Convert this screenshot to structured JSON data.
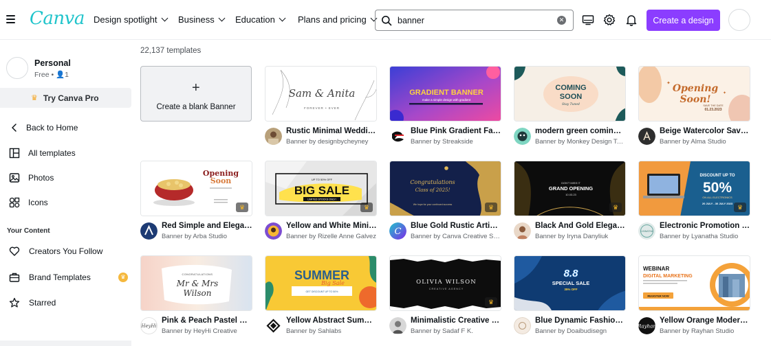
{
  "header": {
    "logo_text": "Canva",
    "nav": [
      {
        "label": "Design spotlight"
      },
      {
        "label": "Business"
      },
      {
        "label": "Education"
      },
      {
        "label": "Plans and pricing"
      }
    ],
    "search_value": "banner",
    "create_label": "Create a design",
    "icons": [
      "monitor-icon",
      "gear-icon",
      "bell-icon"
    ]
  },
  "sidebar": {
    "account_name": "Personal",
    "account_sub": "Free • 👤1",
    "try_pro_label": "Try Canva Pro",
    "items": [
      {
        "label": "Back to Home",
        "icon": "chevron-left-icon"
      },
      {
        "label": "All templates",
        "icon": "templates-icon"
      },
      {
        "label": "Photos",
        "icon": "photo-icon"
      },
      {
        "label": "Icons",
        "icon": "shapes-icon"
      }
    ],
    "section_title": "Your Content",
    "content_items": [
      {
        "label": "Creators You Follow",
        "icon": "heart-icon"
      },
      {
        "label": "Brand Templates",
        "icon": "briefcase-icon"
      },
      {
        "label": "Starred",
        "icon": "star-icon"
      }
    ]
  },
  "main": {
    "count": "22,137 templates",
    "blank_label": "Create a blank Banner",
    "blank_plus": "+",
    "templates": [
      {
        "title": "Rustic Minimal Wedding Banner",
        "by": "Banner by designbycheyney",
        "thumb": {
          "a": "Sam & Anita",
          "b": "FOREVER • EVER"
        }
      },
      {
        "title": "Blue Pink Gradient Fashion Banner",
        "by": "Banner by Streakside",
        "thumb": {
          "a": "GRADIENT BANNER",
          "b": "make a simple design with gradient"
        }
      },
      {
        "title": "modern green coming soon banner",
        "by": "Banner by Monkey Design Team",
        "thumb": {
          "a": "COMING",
          "b": "SOON",
          "c": "Stay Tuned"
        }
      },
      {
        "title": "Beige Watercolor Save the Date",
        "by": "Banner by Alma Studio",
        "thumb": {
          "a": "Opening",
          "b": "Soon!",
          "c": "SAVE THE DATE",
          "d": "01.23.2023"
        }
      },
      {
        "title": "Red Simple and Elegant Banner",
        "by": "Banner by Arba Studio",
        "thumb": {
          "a": "Opening",
          "b": "Soon"
        }
      },
      {
        "title": "Yellow and White Minimalist Banner",
        "by": "Banner by Rizelle Anne Galvez",
        "thumb": {
          "a": "UP TO 50% OFF",
          "b": "BIG SALE",
          "c": "LIMITED STOCKS ONLY!"
        }
      },
      {
        "title": "Blue Gold Rustic Artistic Banner",
        "by": "Banner by Canva Creative Studio",
        "thumb": {
          "a": "Congratulations",
          "b": "Class of 2025!",
          "c": "We hope for your continued success"
        }
      },
      {
        "title": "Black And Gold Elegant Banner",
        "by": "Banner by Iryna Danyliuk",
        "thumb": {
          "a": "DON'T MISS IT",
          "b": "GRAND OPENING",
          "c": "10.03.23"
        }
      },
      {
        "title": "Electronic Promotion Banner",
        "by": "Banner by Lyanatha Studio",
        "thumb": {
          "a": "DISCOUNT UP TO",
          "b": "50%",
          "c": "ON ALL ELECTRONICS",
          "d": "20 JULY - 30 JULY 2023"
        }
      },
      {
        "title": "Pink & Peach Pastel Wedding Banner",
        "by": "Banner by HeyHi Creative",
        "thumb": {
          "a": "CONGRATULATIONS",
          "b": "Mr & Mrs",
          "c": "Wilson"
        }
      },
      {
        "title": "Yellow Abstract Summer Sale Banner",
        "by": "Banner by Sahlabs",
        "thumb": {
          "a": "SUMMER",
          "b": "Big Sale",
          "c": "GET DISCOUNT UP TO 50%"
        }
      },
      {
        "title": "Minimalistic Creative Banner",
        "by": "Banner by Sadaf F K.",
        "thumb": {
          "a": "OLIVIA WILSON",
          "b": "CREATIVE AGENCY"
        }
      },
      {
        "title": "Blue Dynamic Fashion Sale Banner",
        "by": "Banner by Doaibudisegn",
        "thumb": {
          "a": "8.8",
          "b": "SPECIAL SALE",
          "c": "35% OFF"
        }
      },
      {
        "title": "Yellow Orange Modern Webinar Banner",
        "by": "Banner by Rayhan Studio",
        "thumb": {
          "a": "WEBINAR",
          "b": "DIGITAL MARKETING",
          "c": "REGISTER NOW"
        }
      }
    ]
  }
}
